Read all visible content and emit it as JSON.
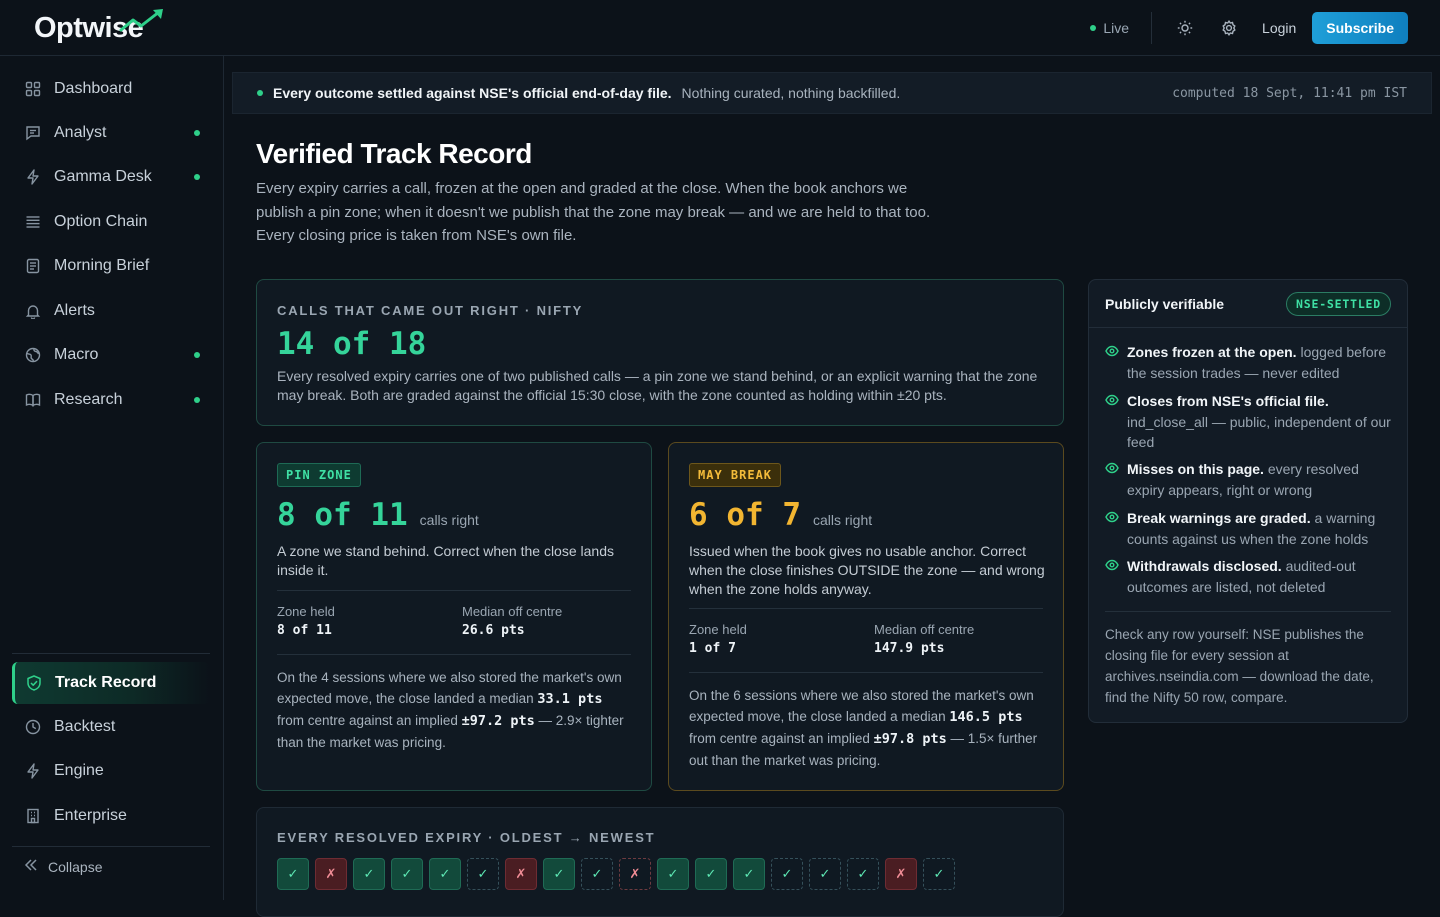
{
  "brand": {
    "name_start": "Opt",
    "name_w": "w",
    "name_end": "ise"
  },
  "topbar": {
    "live_label": "Live",
    "login_label": "Login",
    "subscribe_label": "Subscribe"
  },
  "sidebar": {
    "items": [
      {
        "label": "Dashboard",
        "icon": "grid-icon"
      },
      {
        "label": "Analyst",
        "icon": "chat-icon",
        "dot": true
      },
      {
        "label": "Gamma Desk",
        "icon": "bolt-icon",
        "dot": true
      },
      {
        "label": "Option Chain",
        "icon": "list-icon"
      },
      {
        "label": "Morning Brief",
        "icon": "document-icon"
      },
      {
        "label": "Alerts",
        "icon": "bell-icon"
      },
      {
        "label": "Macro",
        "icon": "globe-icon",
        "dot": true
      },
      {
        "label": "Research",
        "icon": "book-icon",
        "dot": true
      }
    ],
    "bottom_items": [
      {
        "label": "Track Record",
        "icon": "shield-check-icon",
        "active": true
      },
      {
        "label": "Backtest",
        "icon": "clock-icon"
      },
      {
        "label": "Engine",
        "icon": "bolt-icon"
      },
      {
        "label": "Enterprise",
        "icon": "building-icon"
      }
    ],
    "collapse_label": "Collapse"
  },
  "banner": {
    "strong": "Every outcome settled against NSE's official end-of-day file.",
    "soft": "Nothing curated, nothing backfilled.",
    "computed": "computed 18 Sept, 11:41 pm IST"
  },
  "page": {
    "title": "Verified Track Record",
    "description": "Every expiry carries a call, frozen at the open and graded at the close. When the book anchors we publish a pin zone; when it doesn't we publish that the zone may break — and we are held to that too. Every closing price is taken from NSE's own file."
  },
  "summary": {
    "kicker": "CALLS THAT CAME OUT RIGHT · NIFTY",
    "value": "14 of 18",
    "text": "Every resolved expiry carries one of two published calls — a pin zone we stand behind, or an explicit warning that the zone may break. Both are graded against the official 15:30 close, with the zone counted as holding within ±20 pts."
  },
  "pin": {
    "tag": "PIN ZONE",
    "value": "8 of 11",
    "suffix": "calls right",
    "desc": "A zone we stand behind. Correct when the close lands inside it.",
    "stat1_label": "Zone held",
    "stat1_value": "8 of 11",
    "stat2_label": "Median off centre",
    "stat2_value": "26.6 pts",
    "p1": "On the 4 sessions where we also stored the market's own expected move, the close landed a median ",
    "p_b1": "33.1 pts",
    "p2": " from centre against an implied ",
    "p_b2": "±97.2 pts",
    "p3": " — 2.9× tighter than the market was pricing."
  },
  "brk": {
    "tag": "MAY BREAK",
    "value": "6 of 7",
    "suffix": "calls right",
    "desc": "Issued when the book gives no usable anchor. Correct when the close finishes OUTSIDE the zone — and wrong when the zone holds anyway.",
    "stat1_label": "Zone held",
    "stat1_value": "1 of 7",
    "stat2_label": "Median off centre",
    "stat2_value": "147.9 pts",
    "p1": "On the 6 sessions where we also stored the market's own expected move, the close landed a median ",
    "p_b1": "146.5 pts",
    "p2": " from centre against an implied ",
    "p_b2": "±97.8 pts",
    "p3": " — 1.5× further out than the market was pricing."
  },
  "verifiable": {
    "title": "Publicly verifiable",
    "badge": "NSE-SETTLED",
    "items": [
      {
        "strong": "Zones frozen at the open.",
        "text": " logged before the session trades — never edited"
      },
      {
        "strong": "Closes from NSE's official file.",
        "text": " ind_close_all — public, independent of our feed"
      },
      {
        "strong": "Misses on this page.",
        "text": " every resolved expiry appears, right or wrong"
      },
      {
        "strong": "Break warnings are graded.",
        "text": " a warning counts against us when the zone holds"
      },
      {
        "strong": "Withdrawals disclosed.",
        "text": " audited-out outcomes are listed, not deleted"
      }
    ],
    "footer": "Check any row yourself: NSE publishes the closing file for every session at archives.nseindia.com — download the date, find the Nifty 50 row, compare."
  },
  "history": {
    "kicker": "EVERY RESOLVED EXPIRY · OLDEST → NEWEST",
    "outcomes": [
      {
        "kind": "pin",
        "ok": true,
        "mark": "✓"
      },
      {
        "kind": "pin",
        "ok": false,
        "mark": "✗"
      },
      {
        "kind": "pin",
        "ok": true,
        "mark": "✓"
      },
      {
        "kind": "pin",
        "ok": true,
        "mark": "✓"
      },
      {
        "kind": "pin",
        "ok": true,
        "mark": "✓"
      },
      {
        "kind": "break",
        "ok": true,
        "mark": "✓"
      },
      {
        "kind": "pin",
        "ok": false,
        "mark": "✗"
      },
      {
        "kind": "pin",
        "ok": true,
        "mark": "✓"
      },
      {
        "kind": "break",
        "ok": true,
        "mark": "✓"
      },
      {
        "kind": "break",
        "ok": false,
        "mark": "✗"
      },
      {
        "kind": "pin",
        "ok": true,
        "mark": "✓"
      },
      {
        "kind": "pin",
        "ok": true,
        "mark": "✓"
      },
      {
        "kind": "pin",
        "ok": true,
        "mark": "✓"
      },
      {
        "kind": "break",
        "ok": true,
        "mark": "✓"
      },
      {
        "kind": "break",
        "ok": true,
        "mark": "✓"
      },
      {
        "kind": "break",
        "ok": true,
        "mark": "✓"
      },
      {
        "kind": "pin",
        "ok": false,
        "mark": "✗"
      },
      {
        "kind": "break",
        "ok": true,
        "mark": "✓"
      }
    ]
  },
  "colors": {
    "accent_green": "#2fd08a",
    "accent_amber": "#f2b531",
    "miss_red": "#f08c95",
    "subscribe_blue": "#1f9fd8"
  }
}
